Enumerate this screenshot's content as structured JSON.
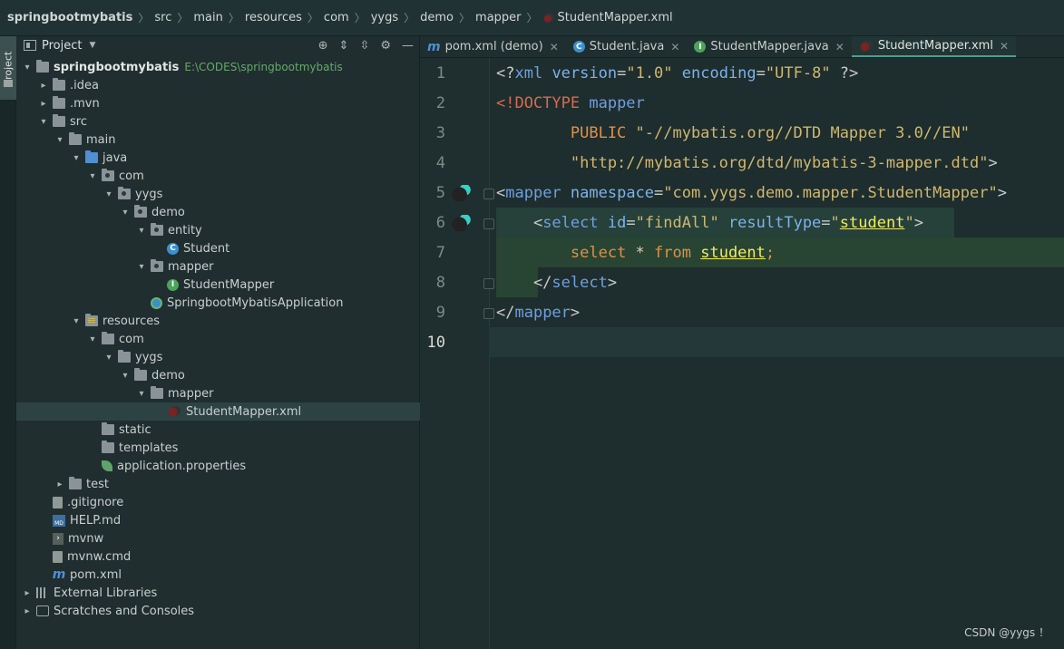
{
  "breadcrumb": {
    "items": [
      "springbootmybatis",
      "src",
      "main",
      "resources",
      "com",
      "yygs",
      "demo",
      "mapper",
      "StudentMapper.xml"
    ]
  },
  "toolstrip": {
    "label": "Project"
  },
  "project": {
    "title": "Project",
    "root": {
      "name": "springbootmybatis",
      "path": "E:\\CODES\\springbootmybatis"
    },
    "tree": [
      ".idea",
      ".mvn",
      "src",
      "main",
      "java",
      "com",
      "yygs",
      "demo",
      "entity",
      "Student",
      "mapper",
      "StudentMapper",
      "SpringbootMybatisApplication",
      "resources",
      "com",
      "yygs",
      "demo",
      "mapper",
      "StudentMapper.xml",
      "static",
      "templates",
      "application.properties",
      "test",
      ".gitignore",
      "HELP.md",
      "mvnw",
      "mvnw.cmd",
      "pom.xml",
      "External Libraries",
      "Scratches and Consoles"
    ]
  },
  "tabs": [
    {
      "label": "pom.xml (demo)",
      "icon": "maven-icon"
    },
    {
      "label": "Student.java",
      "icon": "class-icon"
    },
    {
      "label": "StudentMapper.java",
      "icon": "interface-icon"
    },
    {
      "label": "StudentMapper.xml",
      "icon": "mybatis-icon",
      "active": true
    }
  ],
  "editor": {
    "line_numbers": [
      "1",
      "2",
      "3",
      "4",
      "5",
      "6",
      "7",
      "8",
      "9",
      "10"
    ],
    "current_line": "10",
    "lines": [
      [
        [
          "<?",
          "p"
        ],
        [
          "xml",
          "t"
        ],
        [
          " version",
          "a"
        ],
        [
          "=",
          "p"
        ],
        [
          "\"1.0\"",
          "s"
        ],
        [
          " encoding",
          "a"
        ],
        [
          "=",
          "p"
        ],
        [
          "\"UTF-8\"",
          "s"
        ],
        [
          " ?>",
          "p"
        ]
      ],
      [
        [
          "<!DOCTYPE ",
          "r"
        ],
        [
          "mapper",
          "t"
        ]
      ],
      [
        [
          "        PUBLIC ",
          "k"
        ],
        [
          "\"-//mybatis.org//DTD Mapper 3.0//EN\"",
          "s"
        ]
      ],
      [
        [
          "        \"http://mybatis.org/dtd/mybatis-3-mapper.dtd\"",
          "s"
        ],
        [
          ">",
          "p"
        ]
      ],
      [
        [
          "<",
          "p"
        ],
        [
          "mapper",
          "t"
        ],
        [
          " namespace",
          "a"
        ],
        [
          "=",
          "p"
        ],
        [
          "\"com.yygs.demo.mapper.StudentMapper\"",
          "s"
        ],
        [
          ">",
          "p"
        ]
      ],
      [
        [
          "    <",
          "p"
        ],
        [
          "select",
          "t"
        ],
        [
          " id",
          "a"
        ],
        [
          "=",
          "p"
        ],
        [
          "\"findAll\"",
          "s"
        ],
        [
          " resultType",
          "a"
        ],
        [
          "=",
          "p"
        ],
        [
          "\"",
          "s"
        ],
        [
          "student",
          "u"
        ],
        [
          "\"",
          "s"
        ],
        [
          ">",
          "p"
        ]
      ],
      [
        [
          "        ",
          "p"
        ],
        [
          "select",
          "k"
        ],
        [
          " * ",
          "bt"
        ],
        [
          "from",
          "k"
        ],
        [
          " ",
          "p"
        ],
        [
          "student",
          "u"
        ],
        [
          ";",
          "k"
        ]
      ],
      [
        [
          "    </",
          "p"
        ],
        [
          "select",
          "t"
        ],
        [
          ">",
          "p"
        ]
      ],
      [
        [
          "</",
          "p"
        ],
        [
          "mapper",
          "t"
        ],
        [
          ">",
          "p"
        ]
      ],
      [
        [
          "",
          "p"
        ]
      ]
    ]
  },
  "watermark": "CSDN @yygs ！"
}
